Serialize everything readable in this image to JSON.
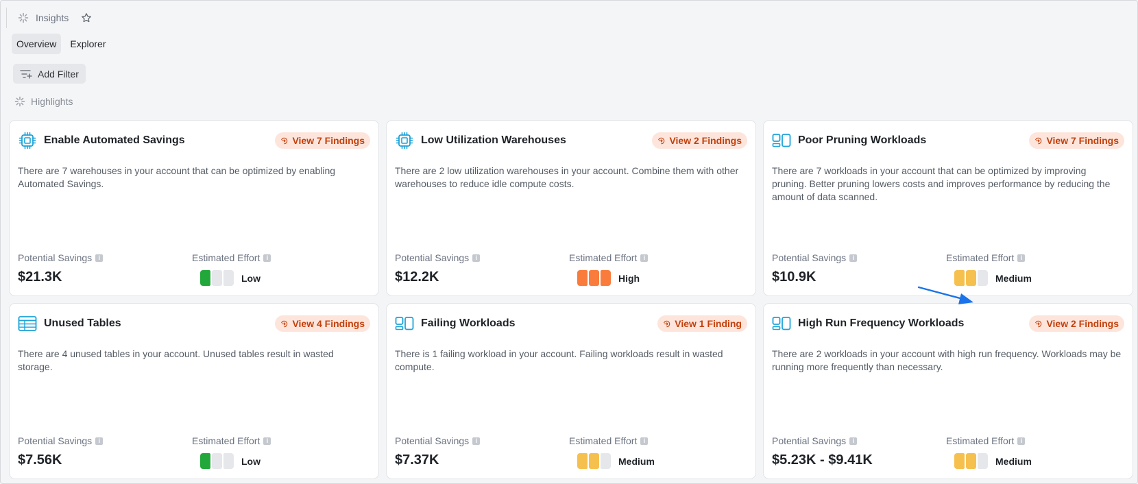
{
  "app": {
    "title": "Insights",
    "tabs": [
      {
        "label": "Overview",
        "active": true
      },
      {
        "label": "Explorer",
        "active": false
      }
    ],
    "filter_label": "Add Filter",
    "section_label": "Highlights"
  },
  "colors": {
    "accent_icon": "#1ba3d8",
    "finding_bg": "#fde5dc",
    "finding_text": "#c2410c",
    "effort_low": "#22a83a",
    "effort_medium": "#f6c04f",
    "effort_high": "#f97c3c",
    "effort_empty": "#e5e7eb"
  },
  "labels": {
    "savings": "Potential Savings",
    "effort": "Estimated Effort"
  },
  "cards": [
    {
      "icon": "chip-icon",
      "title": "Enable Automated Savings",
      "findings": "View 7 Findings",
      "description": "There are 7 warehouses in your account that can be optimized by enabling Automated Savings.",
      "savings": "$21.3K",
      "effort": "Low",
      "effort_level": 1
    },
    {
      "icon": "chip-icon",
      "title": "Low Utilization Warehouses",
      "findings": "View 2 Findings",
      "description": "There are 2 low utilization warehouses in your account. Combine them with other warehouses to reduce idle compute costs.",
      "savings": "$12.2K",
      "effort": "High",
      "effort_level": 3
    },
    {
      "icon": "workload-icon",
      "title": "Poor Pruning Workloads",
      "findings": "View 7 Findings",
      "description": "There are 7 workloads in your account that can be optimized by improving pruning. Better pruning lowers costs and improves performance by reducing the amount of data scanned.",
      "savings": "$10.9K",
      "effort": "Medium",
      "effort_level": 2
    },
    {
      "icon": "table-icon",
      "title": "Unused Tables",
      "findings": "View 4 Findings",
      "description": "There are 4 unused tables in your account. Unused tables result in wasted storage.",
      "savings": "$7.56K",
      "effort": "Low",
      "effort_level": 1
    },
    {
      "icon": "workload-icon",
      "title": "Failing Workloads",
      "findings": "View 1 Finding",
      "description": "There is 1 failing workload in your account. Failing workloads result in wasted compute.",
      "savings": "$7.37K",
      "effort": "Medium",
      "effort_level": 2
    },
    {
      "icon": "workload-icon",
      "title": "High Run Frequency Workloads",
      "findings": "View 2 Findings",
      "description": "There are 2 workloads in your account with high run frequency. Workloads may be running more frequently than necessary.",
      "savings": "$5.23K - $9.41K",
      "effort": "Medium",
      "effort_level": 2
    }
  ]
}
